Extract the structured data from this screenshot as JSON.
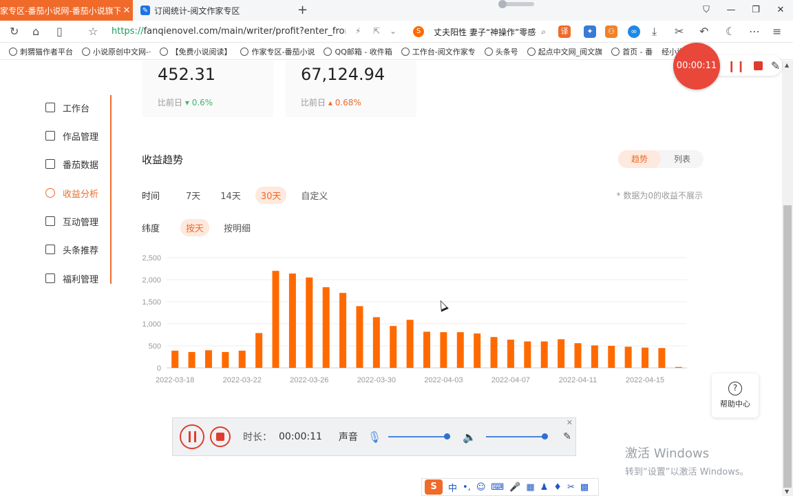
{
  "browser": {
    "tabs": [
      {
        "title": "家专区-番茄小说网-番茄小说旗下",
        "active": true
      },
      {
        "title": "订阅统计-阅文作家专区",
        "active": false
      }
    ],
    "url_scheme": "https://",
    "url_rest": "fanqienovel.com/main/writer/profit?enter_fror",
    "search_text": "丈夫阳性 妻子“神操作”零感",
    "bookmarks": [
      "刺猬猫作者平台",
      "小说原创中文网-·",
      "【免费小说阅读】",
      "作家专区-番茄小说",
      "QQ邮箱 - 收件箱",
      "工作台-阅文作家专",
      "头条号",
      "起点中文网_阅文旗",
      "首页 - 番",
      "经小说 用户 目"
    ]
  },
  "stats": [
    {
      "value": "452.31",
      "compare_label": "比前日",
      "direction": "down",
      "change": "0.6%"
    },
    {
      "value": "67,124.94",
      "compare_label": "比前日",
      "direction": "up",
      "change": "0.68%"
    }
  ],
  "sidebar": {
    "items": [
      {
        "label": "工作台"
      },
      {
        "label": "作品管理"
      },
      {
        "label": "番茄数据"
      },
      {
        "label": "收益分析",
        "active": true
      },
      {
        "label": "互动管理"
      },
      {
        "label": "头条推荐"
      },
      {
        "label": "福利管理"
      }
    ]
  },
  "main": {
    "section_title": "收益趋势",
    "view_toggle": {
      "trend": "趋势",
      "list": "列表",
      "selected": "趋势"
    },
    "time_filter": {
      "label": "时间",
      "options": [
        "7天",
        "14天",
        "30天",
        "自定义"
      ],
      "selected": "30天"
    },
    "dimension_filter": {
      "label": "纬度",
      "options": [
        "按天",
        "按明细"
      ],
      "selected": "按天"
    },
    "note": "* 数据为0的收益不展示"
  },
  "chart_data": {
    "type": "bar",
    "x_tick_labels": [
      "2022-03-18",
      "2022-03-22",
      "2022-03-26",
      "2022-03-30",
      "2022-04-03",
      "2022-04-07",
      "2022-04-11",
      "2022-04-15"
    ],
    "y_ticks": [
      "0",
      "500",
      "1,000",
      "1,500",
      "2,000",
      "2,500"
    ],
    "ylim": [
      0,
      2500
    ],
    "grid": true,
    "color": "#ff6a00",
    "categories": [
      "2022-03-18",
      "2022-03-19",
      "2022-03-20",
      "2022-03-21",
      "2022-03-22",
      "2022-03-23",
      "2022-03-24",
      "2022-03-25",
      "2022-03-26",
      "2022-03-27",
      "2022-03-28",
      "2022-03-29",
      "2022-03-30",
      "2022-03-31",
      "2022-04-01",
      "2022-04-02",
      "2022-04-03",
      "2022-04-04",
      "2022-04-05",
      "2022-04-06",
      "2022-04-07",
      "2022-04-08",
      "2022-04-09",
      "2022-04-10",
      "2022-04-11",
      "2022-04-12",
      "2022-04-13",
      "2022-04-14",
      "2022-04-15",
      "2022-04-16",
      "2022-04-17"
    ],
    "values": [
      390,
      360,
      400,
      360,
      390,
      790,
      2200,
      2140,
      2050,
      1830,
      1700,
      1400,
      1150,
      950,
      1090,
      820,
      810,
      810,
      780,
      700,
      640,
      600,
      600,
      650,
      560,
      510,
      500,
      480,
      460,
      450,
      20
    ]
  },
  "help": {
    "label": "帮助中心",
    "icon": "question-icon"
  },
  "recorder": {
    "duration_label": "时长：",
    "duration_value": "00:00:11",
    "sound_label": "声音",
    "mic_level": 1.0,
    "speaker_level": 1.0,
    "floating_time": "00:00:11",
    "accent": "#e03c2d"
  },
  "watermark": {
    "line1": "激活 Windows",
    "line2": "转到“设置”以激活 Windows。"
  },
  "ime": {
    "logo": "S",
    "mode": "中",
    "punct": "•,"
  }
}
